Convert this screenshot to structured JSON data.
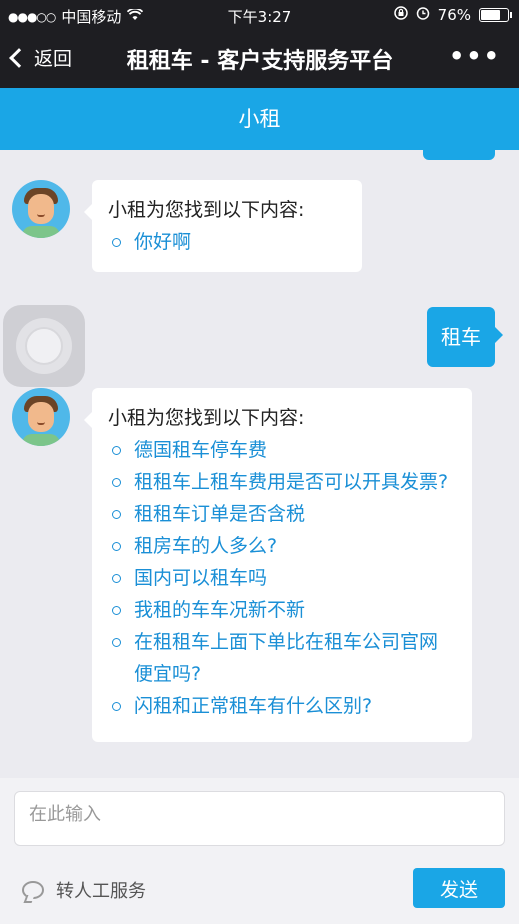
{
  "status_bar": {
    "signal": "●●●○○",
    "carrier": "中国移动",
    "time": "下午3:27",
    "battery": "76%",
    "battery_level": 0.76
  },
  "nav": {
    "back_label": "返回",
    "title": "租租车 - 客户支持服务平台",
    "more": "•••"
  },
  "header": {
    "title": "小租"
  },
  "messages": [
    {
      "from": "bot",
      "intro": "小租为您找到以下内容:",
      "items": [
        "你好啊"
      ]
    },
    {
      "from": "user",
      "text": "租车"
    },
    {
      "from": "bot",
      "intro": "小租为您找到以下内容:",
      "items": [
        "德国租车停车费",
        "租租车上租车费用是否可以开具发票?",
        "租租车订单是否含税",
        "租房车的人多么?",
        "国内可以租车吗",
        "我租的车车况新不新",
        "在租租车上面下单比在租车公司官网便宜吗?",
        "闪租和正常租车有什么区别?"
      ]
    }
  ],
  "input": {
    "placeholder": "在此输入"
  },
  "human_service_label": "转人工服务",
  "send_label": "发送",
  "colors": {
    "accent": "#1aa6e6",
    "navbar": "#1e1e22",
    "link": "#1a8fd6"
  }
}
